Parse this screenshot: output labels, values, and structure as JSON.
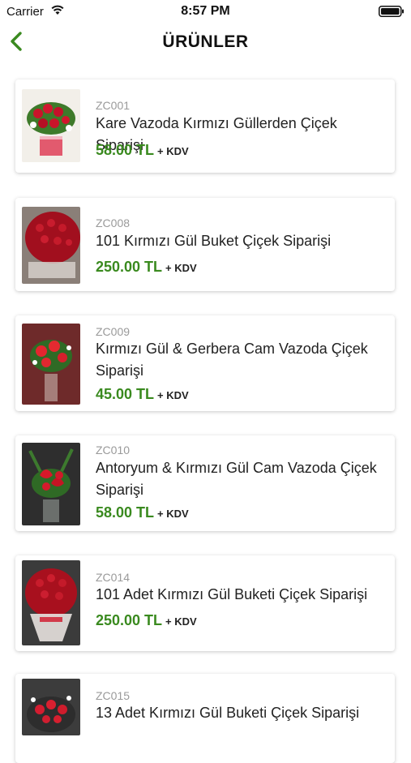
{
  "status_bar": {
    "carrier": "Carrier",
    "time": "8:57 PM"
  },
  "nav": {
    "title": "ÜRÜNLER"
  },
  "products": [
    {
      "code": "ZC001",
      "name": "Kare Vazoda Kırmızı Güllerden Çiçek Siparişi",
      "price": "58.00 TL",
      "tax": "+ KDV"
    },
    {
      "code": "ZC008",
      "name": "101 Kırmızı Gül Buket Çiçek Siparişi",
      "price": "250.00 TL",
      "tax": "+ KDV"
    },
    {
      "code": "ZC009",
      "name": "Kırmızı Gül & Gerbera Cam Vazoda Çiçek Siparişi",
      "price": "45.00 TL",
      "tax": "+ KDV"
    },
    {
      "code": "ZC010",
      "name": "Antoryum & Kırmızı Gül Cam Vazoda Çiçek Siparişi",
      "price": "58.00 TL",
      "tax": "+ KDV"
    },
    {
      "code": "ZC014",
      "name": "101 Adet Kırmızı Gül Buketi Çiçek Siparişi",
      "price": "250.00 TL",
      "tax": "+ KDV"
    },
    {
      "code": "ZC015",
      "name": "13 Adet Kırmızı Gül Buketi Çiçek Siparişi"
    }
  ],
  "colors": {
    "accent": "#3a8a1f",
    "code_gray": "#9a9a9a"
  },
  "icons": {
    "back": "chevron-left-icon",
    "wifi": "wifi-icon",
    "battery": "battery-icon"
  }
}
